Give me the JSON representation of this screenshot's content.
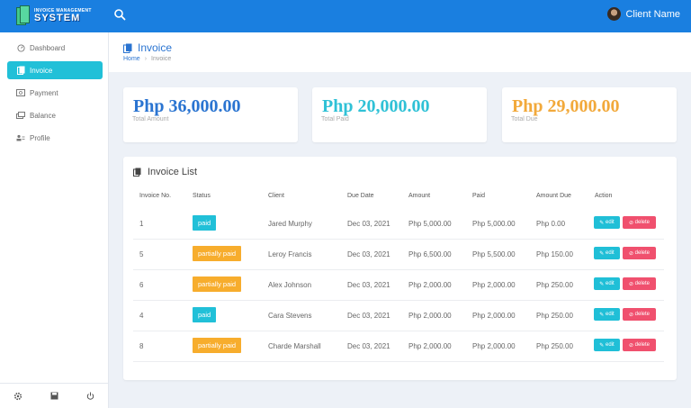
{
  "app": {
    "logo_line1": "INVOICE MANAGEMENT",
    "logo_line2": "SYSTEM",
    "user_name": "Client Name"
  },
  "icons": {
    "search": "search-icon",
    "dashboard": "dashboard-icon",
    "invoice": "document-icon",
    "payment": "payment-icon",
    "balance": "money-icon",
    "profile": "profile-icon",
    "settings": "gear-icon",
    "save": "floppy-icon",
    "power": "power-icon"
  },
  "colors": {
    "topbar": "#1a7fe0",
    "active_nav": "#21c0d8",
    "total_amount": "#2a74d1",
    "total_paid": "#2fc1d6",
    "total_due": "#f2a93b",
    "badge_paid": "#21c0d8",
    "badge_partial": "#f7ad2d",
    "edit": "#20bfd7",
    "delete": "#f0506e"
  },
  "sidebar": {
    "items": [
      {
        "label": "Dashboard"
      },
      {
        "label": "Invoice"
      },
      {
        "label": "Payment"
      },
      {
        "label": "Balance"
      },
      {
        "label": "Profile"
      }
    ]
  },
  "header": {
    "title": "Invoice",
    "breadcrumb_home": "Home",
    "breadcrumb_current": "Invoice"
  },
  "stats": [
    {
      "amount": "Php 36,000.00",
      "label": "Total Amount"
    },
    {
      "amount": "Php 20,000.00",
      "label": "Total Paid"
    },
    {
      "amount": "Php 29,000.00",
      "label": "Total Due"
    }
  ],
  "invoice_list": {
    "title": "Invoice List",
    "columns": [
      "Invoice No.",
      "Status",
      "Client",
      "Due Date",
      "Amount",
      "Paid",
      "Amount Due",
      "Action"
    ],
    "edit_label": "edit",
    "delete_label": "delete",
    "rows": [
      {
        "no": "1",
        "status": "paid",
        "client": "Jared Murphy",
        "due_date": "Dec 03, 2021",
        "amount": "Php 5,000.00",
        "paid": "Php 5,000.00",
        "amount_due": "Php 0.00"
      },
      {
        "no": "5",
        "status": "partially paid",
        "client": "Leroy Francis",
        "due_date": "Dec 03, 2021",
        "amount": "Php 6,500.00",
        "paid": "Php 5,500.00",
        "amount_due": "Php 150.00"
      },
      {
        "no": "6",
        "status": "partially paid",
        "client": "Alex Johnson",
        "due_date": "Dec 03, 2021",
        "amount": "Php 2,000.00",
        "paid": "Php 2,000.00",
        "amount_due": "Php 250.00"
      },
      {
        "no": "4",
        "status": "paid",
        "client": "Cara Stevens",
        "due_date": "Dec 03, 2021",
        "amount": "Php 2,000.00",
        "paid": "Php 2,000.00",
        "amount_due": "Php 250.00"
      },
      {
        "no": "8",
        "status": "partially paid",
        "client": "Charde Marshall",
        "due_date": "Dec 03, 2021",
        "amount": "Php 2,000.00",
        "paid": "Php 2,000.00",
        "amount_due": "Php 250.00"
      }
    ]
  }
}
